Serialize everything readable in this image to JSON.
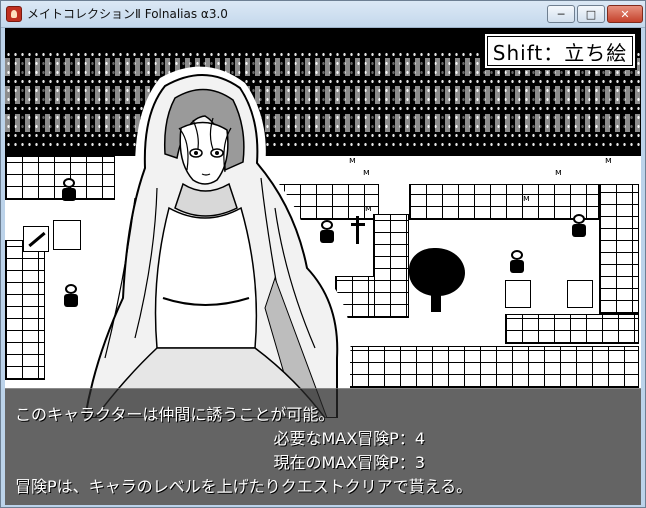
{
  "window": {
    "title": "メイトコレクションⅡ Folnalias α3.0",
    "minimize_label": "─",
    "maximize_label": "□",
    "close_label": "✕"
  },
  "hud": {
    "shift_hint": "Shift：立ち絵"
  },
  "map": {
    "grass_marks": [
      "ᴍ",
      "ᴍ",
      "ᴍ",
      "ᴍ",
      "ᴍ",
      "ᴍ"
    ]
  },
  "message": {
    "line1": "このキャラクターは仲間に誘うことが可能。",
    "line2": "必要なMAX冒険P：4",
    "line3": "現在のMAX冒険P：3",
    "line4": "冒険Pは、キャラのレベルを上げたりクエストクリアで貰える。"
  },
  "colors": {
    "message_bg": "#282828",
    "message_text": "#ffffff",
    "titlebar": "#c4d8ec",
    "close_button": "#c4422c"
  }
}
